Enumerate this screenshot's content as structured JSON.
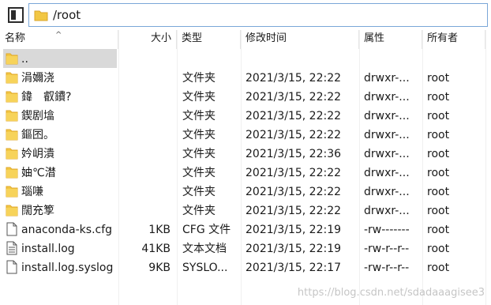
{
  "path": {
    "value": "/root"
  },
  "columns": {
    "name": "名称",
    "size": "大小",
    "type": "类型",
    "modified": "修改时间",
    "attributes": "属性",
    "owner": "所有者"
  },
  "files": [
    {
      "icon": "folder-icon",
      "name": "..",
      "size": "",
      "type": "",
      "modified": "",
      "attributes": "",
      "owner": ""
    },
    {
      "icon": "folder-icon",
      "name": "涓嬭浇",
      "size": "",
      "type": "文件夹",
      "modified": "2021/3/15, 22:22",
      "attributes": "drwxr-...",
      "owner": "root"
    },
    {
      "icon": "folder-icon",
      "name": "鍏　叡鐨?",
      "size": "",
      "type": "文件夹",
      "modified": "2021/3/15, 22:22",
      "attributes": "drwxr-...",
      "owner": "root"
    },
    {
      "icon": "folder-icon",
      "name": "鍥剧墖",
      "size": "",
      "type": "文件夹",
      "modified": "2021/3/15, 22:22",
      "attributes": "drwxr-...",
      "owner": "root"
    },
    {
      "icon": "folder-icon",
      "name": "鏂囨。",
      "size": "",
      "type": "文件夹",
      "modified": "2021/3/15, 22:22",
      "attributes": "drwxr-...",
      "owner": "root"
    },
    {
      "icon": "folder-icon",
      "name": "妗岄潰",
      "size": "",
      "type": "文件夹",
      "modified": "2021/3/15, 22:36",
      "attributes": "drwxr-...",
      "owner": "root"
    },
    {
      "icon": "folder-icon",
      "name": "妯℃澘",
      "size": "",
      "type": "文件夹",
      "modified": "2021/3/15, 22:22",
      "attributes": "drwxr-...",
      "owner": "root"
    },
    {
      "icon": "folder-icon",
      "name": "瑙嗛",
      "size": "",
      "type": "文件夹",
      "modified": "2021/3/15, 22:22",
      "attributes": "drwxr-...",
      "owner": "root"
    },
    {
      "icon": "folder-icon",
      "name": "闊充箰",
      "size": "",
      "type": "文件夹",
      "modified": "2021/3/15, 22:22",
      "attributes": "drwxr-...",
      "owner": "root"
    },
    {
      "icon": "file-icon",
      "name": "anaconda-ks.cfg",
      "size": "1KB",
      "type": "CFG 文件",
      "modified": "2021/3/15, 22:19",
      "attributes": "-rw-------",
      "owner": "root"
    },
    {
      "icon": "text-file-icon",
      "name": "install.log",
      "size": "41KB",
      "type": "文本文档",
      "modified": "2021/3/15, 22:19",
      "attributes": "-rw-r--r--",
      "owner": "root"
    },
    {
      "icon": "file-icon",
      "name": "install.log.syslog",
      "size": "9KB",
      "type": "SYSLO...",
      "modified": "2021/3/15, 22:17",
      "attributes": "-rw-r--r--",
      "owner": "root"
    }
  ],
  "watermark": "https://blog.csdn.net/sdadaaagisee3",
  "colors": {
    "folder": "#f2c744",
    "folder_dark": "#e0a92b",
    "selected": "#d9d9d9",
    "path_border": "#7aa7d8"
  }
}
